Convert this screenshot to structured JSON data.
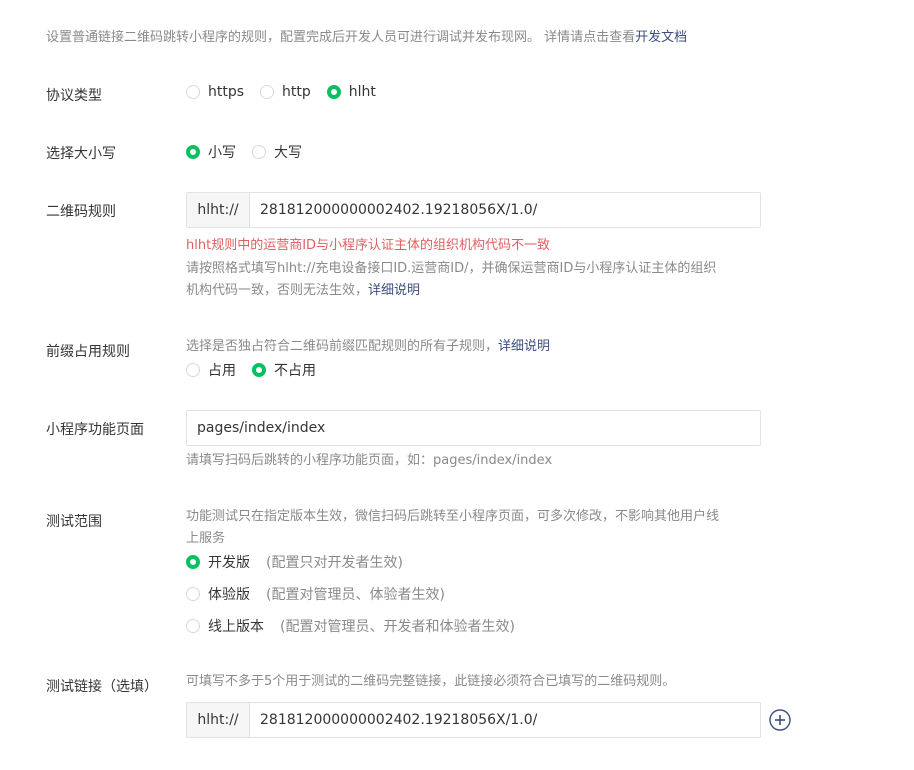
{
  "intro": {
    "text": "设置普通链接二维码跳转小程序的规则，配置完成后开发人员可进行调试并发布现网。 详情请点击查看",
    "link": "开发文档"
  },
  "protocol": {
    "label": "协议类型",
    "options": [
      "https",
      "http",
      "hlht"
    ],
    "selected": "hlht"
  },
  "case": {
    "label": "选择大小写",
    "options": [
      "小写",
      "大写"
    ],
    "selected": "小写"
  },
  "qr_rule": {
    "label": "二维码规则",
    "prefix": "hlht://",
    "value": "281812000000002402.19218056X/1.0/",
    "error": "hlht规则中的运营商ID与小程序认证主体的组织机构代码不一致",
    "tip_line1": "请按照格式填写hlht://充电设备接口ID.运营商ID/，并确保运营商ID与小程序认证主体的组织",
    "tip_line2": "机构代码一致，否则无法生效，",
    "tip_link": "详细说明"
  },
  "prefix_rule": {
    "label": "前缀占用规则",
    "tip": "选择是否独占符合二维码前缀匹配规则的所有子规则，",
    "tip_link": "详细说明",
    "options": [
      "占用",
      "不占用"
    ],
    "selected": "不占用"
  },
  "page_path": {
    "label": "小程序功能页面",
    "value": "pages/index/index",
    "tip": "请填写扫码后跳转的小程序功能页面，如：pages/index/index"
  },
  "test_scope": {
    "label": "测试范围",
    "tip_line1": "功能测试只在指定版本生效，微信扫码后跳转至小程序页面，可多次修改，不影响其他用户线",
    "tip_line2": "上服务",
    "options": [
      {
        "name": "开发版",
        "note": "(配置只对开发者生效)"
      },
      {
        "name": "体验版",
        "note": "(配置对管理员、体验者生效)"
      },
      {
        "name": "线上版本",
        "note": "(配置对管理员、开发者和体验者生效)"
      }
    ],
    "selected": "开发版"
  },
  "test_link": {
    "label": "测试链接（选填）",
    "tip": "可填写不多于5个用于测试的二维码完整链接，此链接必须符合已填写的二维码规则。",
    "prefix": "hlht://",
    "value": "281812000000002402.19218056X/1.0/"
  },
  "icons": {
    "add": "plus-circle-icon"
  },
  "colors": {
    "accent": "#07c160",
    "error": "#e15f63",
    "link": "#3c4f7e",
    "muted": "#8a8a8a"
  }
}
